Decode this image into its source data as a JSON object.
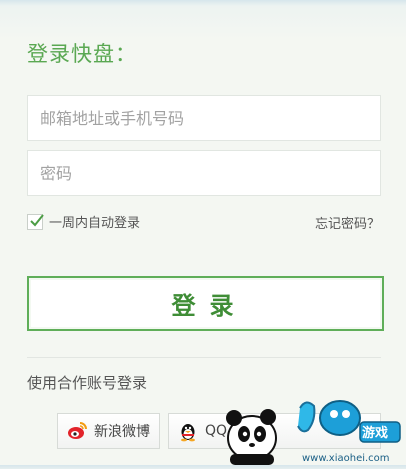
{
  "title": "登录快盘：",
  "email_field": {
    "placeholder": "邮箱地址或手机号码",
    "value": ""
  },
  "password_field": {
    "placeholder": "密码",
    "value": ""
  },
  "remember": {
    "label": "一周内自动登录",
    "checked": true
  },
  "forgot_link": "忘记密码？",
  "login_button": "登录",
  "social": {
    "label": "使用合作账号登录",
    "weibo_label": "新浪微博",
    "qq_label": "QQ"
  },
  "watermark": {
    "logo_text": "小黑游戏",
    "url": "www.xiaohei.com"
  },
  "colors": {
    "accent_green": "#5aa852",
    "button_text": "#3f8d36",
    "background": "#f4f7f2"
  },
  "icons": [
    "check-icon",
    "weibo-icon",
    "qq-penguin-icon",
    "panda-mascot"
  ]
}
